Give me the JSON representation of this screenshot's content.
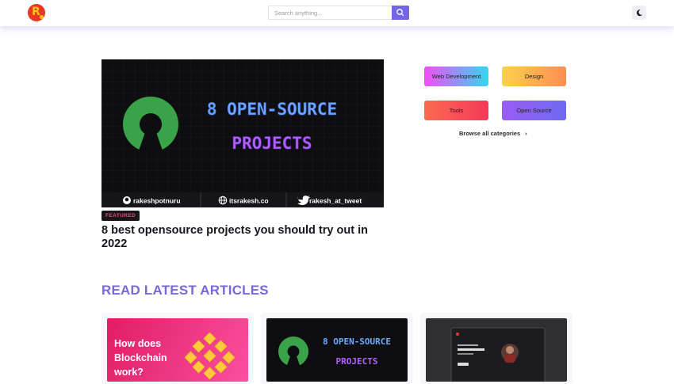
{
  "header": {
    "search_placeholder": "Search anything...",
    "logo_letter": "R"
  },
  "featured": {
    "image": {
      "title_line1": "8 OPEN-SOURCE",
      "title_line2": "PROJECTS",
      "social_github": "rakeshpotnuru",
      "social_web": "itsrakesh.co",
      "social_twitter": "rakesh_at_tweet"
    },
    "badge": "FEATURED",
    "title": "8 best opensource projects you should try out in 2022"
  },
  "categories": {
    "items": [
      "Web Development",
      "Design",
      "Tools",
      "Open Source"
    ],
    "browse_all": "Browse all categories",
    "browse_chevron": "›"
  },
  "latest": {
    "heading": "READ LATEST ARTICLES",
    "cards": [
      {
        "thumb_text_lines": [
          "How does",
          "Blockchain",
          "work?"
        ]
      },
      {
        "thumb_text_lines": [
          "8 OPEN-SOURCE",
          "PROJECTS"
        ]
      },
      {
        "thumb_text_lines": []
      }
    ]
  },
  "colors": {
    "accent": "#7266e6",
    "heading": "#7b66de",
    "badge_text": "#ff3c8c",
    "neon_blue": "#6fa8ff",
    "neon_purple": "#b061ff",
    "os_green": "#3aa34a"
  },
  "icons": [
    "logo",
    "search-icon",
    "moon-icon",
    "github-icon",
    "globe-icon",
    "twitter-icon",
    "chevron-right-icon"
  ]
}
